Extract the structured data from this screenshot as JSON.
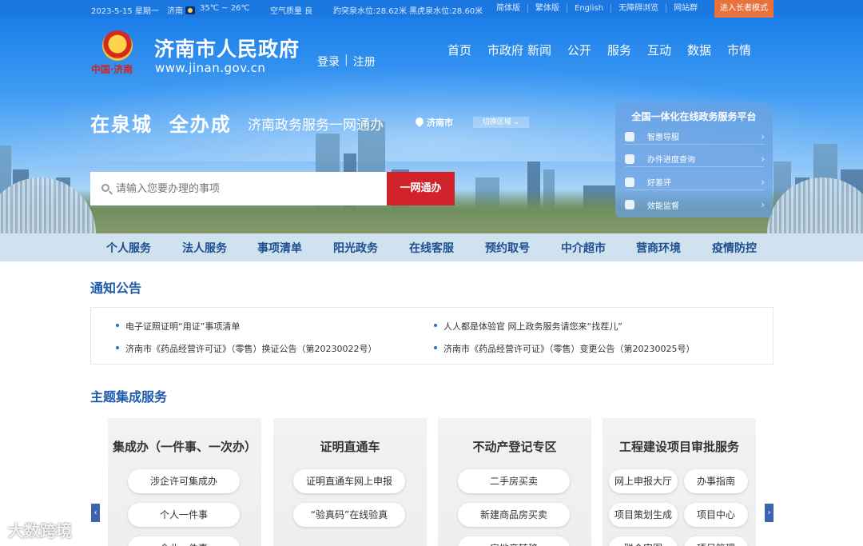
{
  "topbar": {
    "date": "2023-5-15 星期一",
    "city": "济南",
    "temp": "35℃ ~ 26℃",
    "air": "空气质量 良",
    "water": "趵突泉水位:28.62米 黑虎泉水位:28.60米",
    "links": [
      "简体版",
      "繁体版",
      "English",
      "无障碍浏览",
      "网站群"
    ],
    "elder_mode": "进入长者模式"
  },
  "header": {
    "emblem_caption": "中国·济南",
    "title": "济南市人民政府",
    "url": "www.jinan.gov.cn",
    "login": "登录",
    "register": "注册",
    "nav": [
      "首页",
      "市政府",
      "新闻",
      "公开",
      "服务",
      "互动",
      "数据",
      "市情"
    ]
  },
  "hero": {
    "slogan_a": "在泉城",
    "slogan_b": "全办成",
    "subtitle": "济南政务服务一网通办",
    "location": "济南市",
    "switch_region": "切换区域",
    "search_placeholder": "请输入您要办理的事项",
    "search_button": "一网通办"
  },
  "platform": {
    "title": "全国一体化在线政务服务平台",
    "items": [
      "智惠导服",
      "办件进度查询",
      "好差评",
      "效能监督"
    ]
  },
  "service_nav": [
    "个人服务",
    "法人服务",
    "事项清单",
    "阳光政务",
    "在线客服",
    "预约取号",
    "中介超市",
    "营商环境",
    "疫情防控"
  ],
  "notices": {
    "title": "通知公告",
    "items": [
      "电子证照证明“用证”事项清单",
      "人人都是体验官 网上政务服务请您来“找茬儿”",
      "济南市《药品经营许可证》（零售）换证公告（第20230022号）",
      "济南市《药品经营许可证》（零售）变更公告（第20230025号）"
    ]
  },
  "themes": {
    "title": "主题集成服务",
    "cards": [
      {
        "title": "集成办（一件事、一次办）",
        "items": [
          "涉企许可集成办",
          "个人一件事",
          "企业一件事"
        ]
      },
      {
        "title": "证明直通车",
        "items": [
          "证明直通车网上申报",
          "“验真码”在线验真"
        ]
      },
      {
        "title": "不动产登记专区",
        "items": [
          "二手房买卖",
          "新建商品房买卖",
          "房地产转移"
        ]
      },
      {
        "title": "工程建设项目审批服务",
        "items": [
          "网上申报大厅",
          "办事指南",
          "项目策划生成",
          "项目中心",
          "联合审图",
          "项目管理"
        ]
      }
    ]
  },
  "watermark": "大数跨境",
  "colors": {
    "primary": "#1a78e0",
    "accent_red": "#d0232c",
    "elder_orange": "#e9713c",
    "heading_blue": "#1d5baa"
  }
}
